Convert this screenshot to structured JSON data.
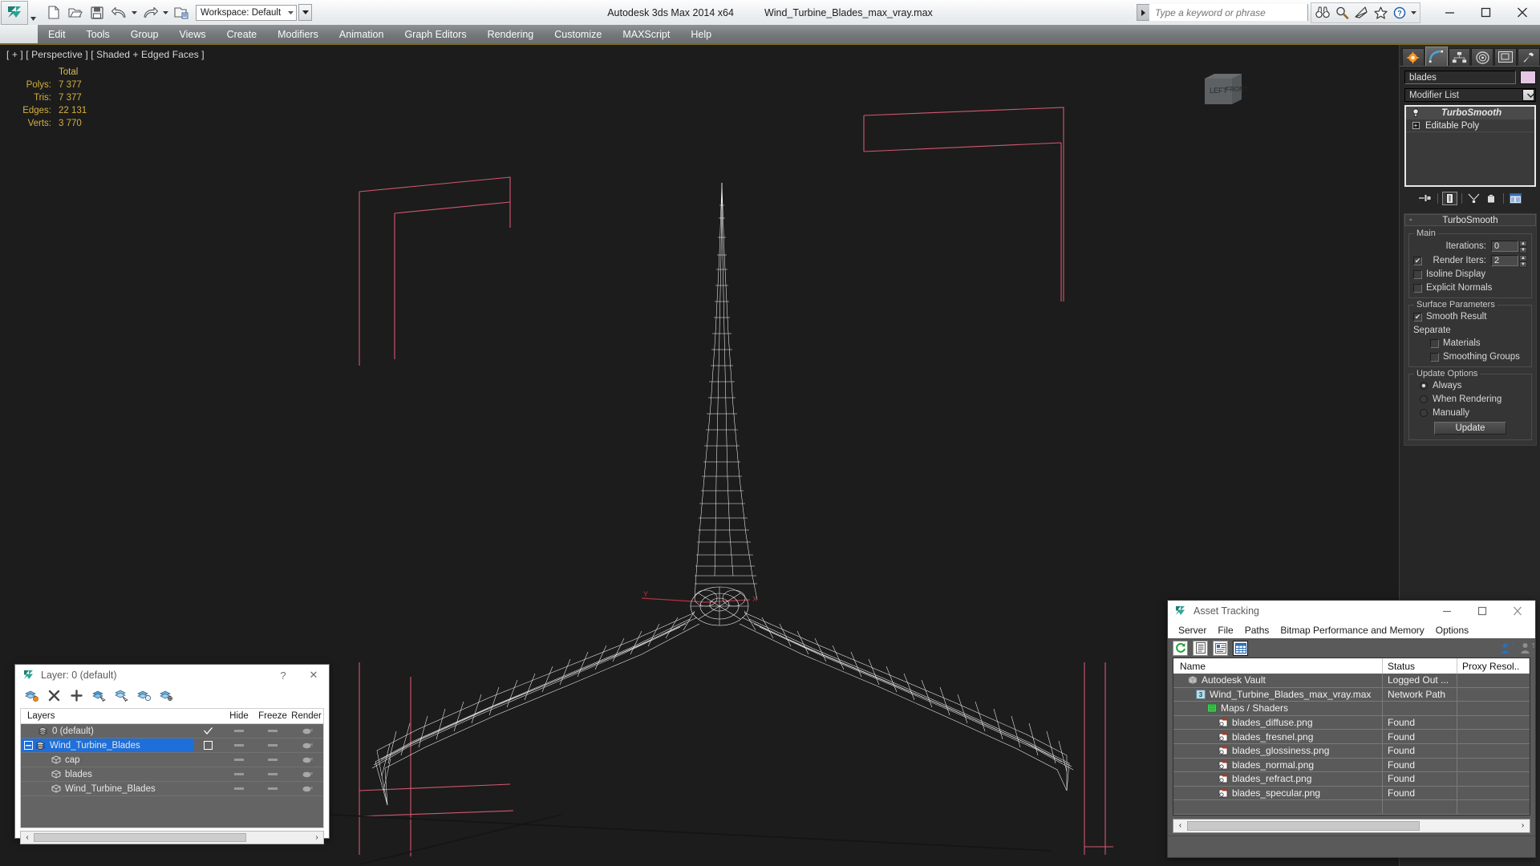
{
  "titlebar": {
    "workspace_label": "Workspace: Default",
    "app_title": "Autodesk 3ds Max  2014 x64",
    "file_name": "Wind_Turbine_Blades_max_vray.max",
    "search_placeholder": "Type a keyword or phrase",
    "search_value": "",
    "quick_access": [
      {
        "name": "new-file-icon",
        "label": "New"
      },
      {
        "name": "open-file-icon",
        "label": "Open"
      },
      {
        "name": "save-file-icon",
        "label": "Save"
      },
      {
        "name": "undo-icon",
        "label": "Undo"
      },
      {
        "name": "redo-icon",
        "label": "Redo"
      },
      {
        "name": "set-project-folder-icon",
        "label": "Set Project Folder"
      }
    ],
    "help_icons": [
      {
        "name": "search-binoculars-icon",
        "label": "Find"
      },
      {
        "name": "magnifier-icon",
        "label": "Zoom"
      },
      {
        "name": "satellite-dish-icon",
        "label": "Communication Center"
      },
      {
        "name": "favorites-star-icon",
        "label": "Favorites"
      },
      {
        "name": "help-question-icon",
        "label": "Help"
      }
    ],
    "window_buttons": [
      {
        "name": "minimize-button",
        "glyph": "—"
      },
      {
        "name": "maximize-button",
        "glyph": "□"
      },
      {
        "name": "close-button",
        "glyph": "✕"
      }
    ]
  },
  "menubar": {
    "items": [
      "Edit",
      "Tools",
      "Group",
      "Views",
      "Create",
      "Modifiers",
      "Animation",
      "Graph Editors",
      "Rendering",
      "Customize",
      "MAXScript",
      "Help"
    ]
  },
  "viewport": {
    "label": "[ + ] [ Perspective ] [ Shaded + Edged Faces ]",
    "stats": {
      "header": "Total",
      "rows": [
        {
          "label": "Polys:",
          "value": "7 377"
        },
        {
          "label": "Tris:",
          "value": "7 377"
        },
        {
          "label": "Edges:",
          "value": "22 131"
        },
        {
          "label": "Verts:",
          "value": "3 770"
        }
      ]
    },
    "viewcube": {
      "face_left": "LEFT",
      "face_front": "FRONT"
    }
  },
  "command_panel": {
    "tabs": [
      {
        "name": "create-tab",
        "label": "Create"
      },
      {
        "name": "modify-tab",
        "label": "Modify"
      },
      {
        "name": "hierarchy-tab",
        "label": "Hierarchy"
      },
      {
        "name": "motion-tab",
        "label": "Motion"
      },
      {
        "name": "display-tab",
        "label": "Display"
      },
      {
        "name": "utilities-tab",
        "label": "Utilities"
      }
    ],
    "active_tab_index": 1,
    "object_name": "blades",
    "object_color": "#e3c7e5",
    "modifier_list_label": "Modifier List",
    "modifier_stack": [
      {
        "label": "TurboSmooth",
        "selected": true,
        "has_plus": false
      },
      {
        "label": "Editable Poly",
        "selected": false,
        "has_plus": true
      }
    ],
    "stack_tools": [
      {
        "name": "pin-stack-icon"
      },
      {
        "name": "show-end-result-icon"
      },
      {
        "name": "make-unique-icon"
      },
      {
        "name": "remove-modifier-icon"
      },
      {
        "name": "configure-modifier-sets-icon"
      }
    ],
    "rollout": {
      "title": "TurboSmooth",
      "collapse_glyph": "-",
      "groups": [
        {
          "title": "Main",
          "fields": [
            {
              "type": "spinner",
              "label": "Iterations:",
              "value": "0",
              "checkbox": null
            },
            {
              "type": "spinner",
              "label": "Render Iters:",
              "value": "2",
              "checkbox": true
            }
          ],
          "checkboxes": [
            {
              "label": "Isoline Display",
              "checked": false
            },
            {
              "label": "Explicit Normals",
              "checked": false
            }
          ]
        },
        {
          "title": "Surface Parameters",
          "checkboxes": [
            {
              "label": "Smooth Result",
              "checked": true
            }
          ],
          "sub_label": "Separate",
          "sub_checkboxes": [
            {
              "label": "Materials",
              "checked": false
            },
            {
              "label": "Smoothing Groups",
              "checked": false
            }
          ]
        },
        {
          "title": "Update Options",
          "radios": [
            {
              "label": "Always",
              "checked": true
            },
            {
              "label": "When Rendering",
              "checked": false
            },
            {
              "label": "Manually",
              "checked": false
            }
          ],
          "button": "Update"
        }
      ]
    }
  },
  "layer_dialog": {
    "title": "Layer: 0 (default)",
    "help_glyph": "?",
    "close_glyph": "✕",
    "toolbar": [
      {
        "name": "set-current-layer-icon"
      },
      {
        "name": "delete-layer-icon"
      },
      {
        "name": "create-new-layer-icon"
      },
      {
        "name": "add-selected-objects-icon"
      },
      {
        "name": "select-objects-in-layer-icon"
      },
      {
        "name": "select-highlighted-objects-icon"
      },
      {
        "name": "layer-properties-icon"
      }
    ],
    "columns": [
      "Layers",
      "",
      "Hide",
      "Freeze",
      "Render"
    ],
    "rows": [
      {
        "label": "0 (default)",
        "indent": 0,
        "icon": "layer-icon",
        "current": true,
        "selected": false,
        "expander": null
      },
      {
        "label": "Wind_Turbine_Blades",
        "indent": 0,
        "icon": "layer-icon",
        "current": false,
        "selected": true,
        "expander": "-"
      },
      {
        "label": "cap",
        "indent": 1,
        "icon": "object-icon",
        "current": false,
        "selected": false,
        "expander": null
      },
      {
        "label": "blades",
        "indent": 1,
        "icon": "object-icon",
        "current": false,
        "selected": false,
        "expander": null
      },
      {
        "label": "Wind_Turbine_Blades",
        "indent": 1,
        "icon": "object-icon",
        "current": false,
        "selected": false,
        "expander": null
      }
    ]
  },
  "asset_tracking": {
    "title": "Asset Tracking",
    "window_buttons": [
      {
        "name": "at-minimize-button",
        "glyph": "—"
      },
      {
        "name": "at-maximize-button",
        "glyph": "□"
      },
      {
        "name": "at-close-button",
        "glyph": "✕"
      }
    ],
    "menu": [
      "Server",
      "File",
      "Paths",
      "Bitmap Performance and Memory",
      "Options"
    ],
    "toolbar": [
      {
        "name": "refresh-icon",
        "active": false
      },
      {
        "name": "list-view-icon",
        "active": false
      },
      {
        "name": "detail-view-icon",
        "active": false
      },
      {
        "name": "grid-view-icon",
        "active": true
      }
    ],
    "toolbar_right": [
      {
        "name": "add-user-help-icon"
      },
      {
        "name": "user-help-icon"
      }
    ],
    "columns": [
      "Name",
      "Status",
      "Proxy Resol.."
    ],
    "rows": [
      {
        "name": "Autodesk Vault",
        "status": "Logged Out ...",
        "proxy": "",
        "indent": 0,
        "icon": "vault-icon"
      },
      {
        "name": "Wind_Turbine_Blades_max_vray.max",
        "status": "Network Path",
        "proxy": "",
        "indent": 1,
        "icon": "max-file-icon"
      },
      {
        "name": "Maps / Shaders",
        "status": "",
        "proxy": "",
        "indent": 2,
        "icon": "maps-shaders-icon"
      },
      {
        "name": "blades_diffuse.png",
        "status": "Found",
        "proxy": "",
        "indent": 3,
        "icon": "bitmap-icon"
      },
      {
        "name": "blades_fresnel.png",
        "status": "Found",
        "proxy": "",
        "indent": 3,
        "icon": "bitmap-icon"
      },
      {
        "name": "blades_glossiness.png",
        "status": "Found",
        "proxy": "",
        "indent": 3,
        "icon": "bitmap-icon"
      },
      {
        "name": "blades_normal.png",
        "status": "Found",
        "proxy": "",
        "indent": 3,
        "icon": "bitmap-icon"
      },
      {
        "name": "blades_refract.png",
        "status": "Found",
        "proxy": "",
        "indent": 3,
        "icon": "bitmap-icon"
      },
      {
        "name": "blades_specular.png",
        "status": "Found",
        "proxy": "",
        "indent": 3,
        "icon": "bitmap-icon"
      },
      {
        "name": "",
        "status": "",
        "proxy": "",
        "indent": 0,
        "icon": ""
      }
    ]
  },
  "colors": {
    "viewport_bg": "#1c1c1c",
    "stats_text": "#d4b03c",
    "selection_blue": "#1e6fd9",
    "mesh_white": "#ffffff",
    "helper_pink": "#d4576f",
    "axis_red": "#c0392b",
    "menu_underline": "#7a6a22"
  }
}
